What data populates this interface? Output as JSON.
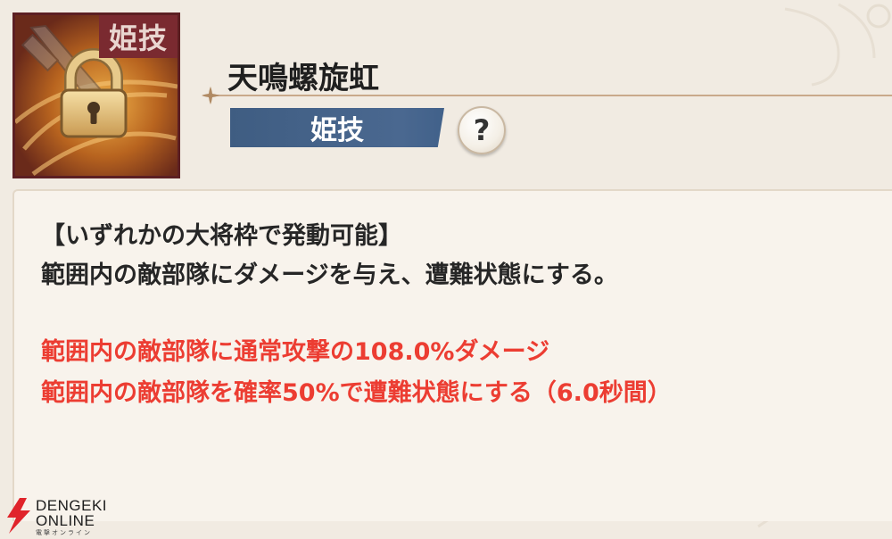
{
  "skill": {
    "icon_tag": "姫技",
    "name": "天鳴螺旋虹",
    "type_badge": "姫技",
    "help_label": "?"
  },
  "description": {
    "lines_black": [
      "【いずれかの大将枠で発動可能】",
      "範囲内の敵部隊にダメージを与え、遭難状態にする。"
    ],
    "lines_red": [
      "範囲内の敵部隊に通常攻撃の108.0%ダメージ",
      "範囲内の敵部隊を確率50%で遭難状態にする（6.0秒間）"
    ]
  },
  "watermark": {
    "line1": "DENGEKI",
    "line2": "ONLINE",
    "sub": "電撃オンライン"
  },
  "colors": {
    "badge_blue": "#44638a",
    "effect_red": "#ec3d32",
    "icon_frame": "#5c1f22"
  }
}
